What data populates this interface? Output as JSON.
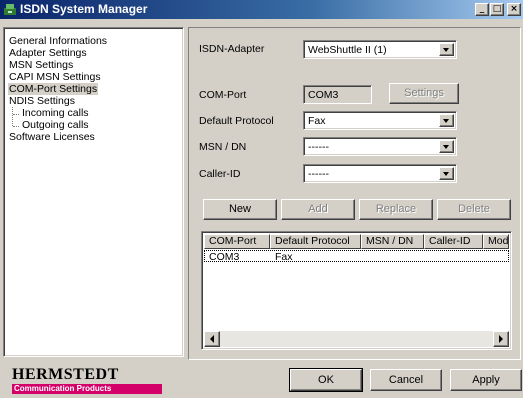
{
  "window": {
    "title": "ISDN System Manager",
    "min_glyph": "_",
    "max_glyph": "□",
    "close_glyph": "×"
  },
  "tree": {
    "items": [
      {
        "label": "General Informations"
      },
      {
        "label": "Adapter Settings"
      },
      {
        "label": "MSN Settings"
      },
      {
        "label": "CAPI MSN Settings"
      },
      {
        "label": "COM-Port Settings",
        "selected": true
      },
      {
        "label": "NDIS Settings"
      },
      {
        "label": "Incoming calls"
      },
      {
        "label": "Outgoing calls"
      },
      {
        "label": "Software Licenses"
      }
    ]
  },
  "adapter": {
    "label": "ISDN-Adapter",
    "value": "WebShuttle II  (1)"
  },
  "com_port": {
    "label": "COM-Port",
    "value": "COM3",
    "settings_button": "Settings"
  },
  "protocol": {
    "label": "Default Protocol",
    "value": "Fax"
  },
  "msn": {
    "label": "MSN / DN",
    "value": "------"
  },
  "caller_id": {
    "label": "Caller-ID",
    "value": "------"
  },
  "actions": {
    "new": "New",
    "add": "Add",
    "replace": "Replace",
    "delete": "Delete"
  },
  "table": {
    "columns": [
      "COM-Port",
      "Default Protocol",
      "MSN / DN",
      "Caller-ID",
      "Mod"
    ],
    "rows": [
      [
        "COM3",
        "Fax",
        "",
        "",
        ""
      ]
    ]
  },
  "logo": {
    "name": "HERMSTEDT",
    "tagline": "Communication Products"
  },
  "footer": {
    "ok": "OK",
    "cancel": "Cancel",
    "apply": "Apply"
  }
}
